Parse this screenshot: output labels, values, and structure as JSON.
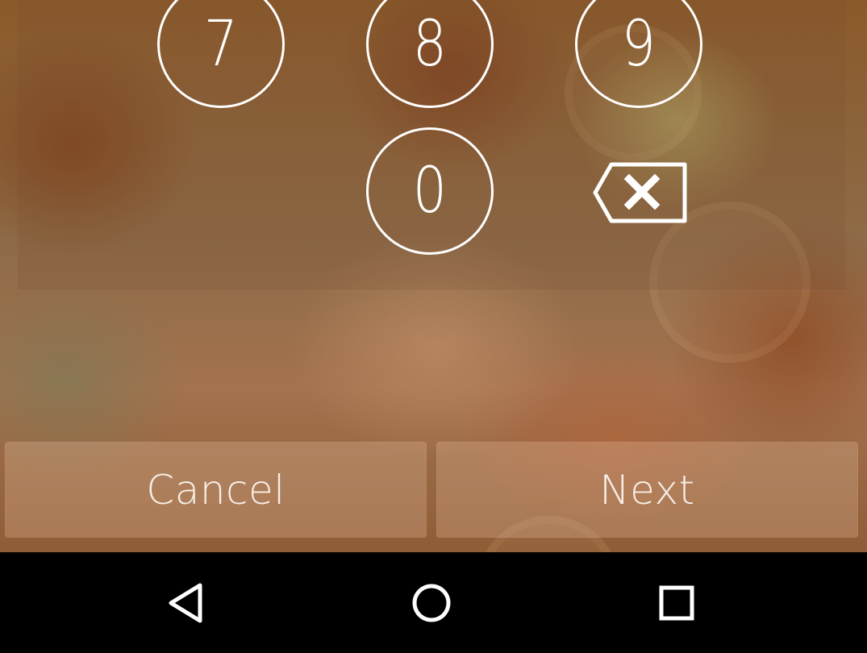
{
  "keypad": {
    "keys": [
      {
        "digit": "7"
      },
      {
        "digit": "8"
      },
      {
        "digit": "9"
      },
      {
        "digit": "0"
      }
    ],
    "backspace_icon": "backspace-icon"
  },
  "actions": {
    "cancel_label": "Cancel",
    "next_label": "Next"
  },
  "navbar": {
    "back_icon": "back-triangle-icon",
    "home_icon": "home-circle-icon",
    "recents_icon": "recents-square-icon"
  },
  "colors": {
    "key_outline": "#ffffff",
    "navbar_background": "#000000",
    "button_text": "#f7efe8"
  }
}
